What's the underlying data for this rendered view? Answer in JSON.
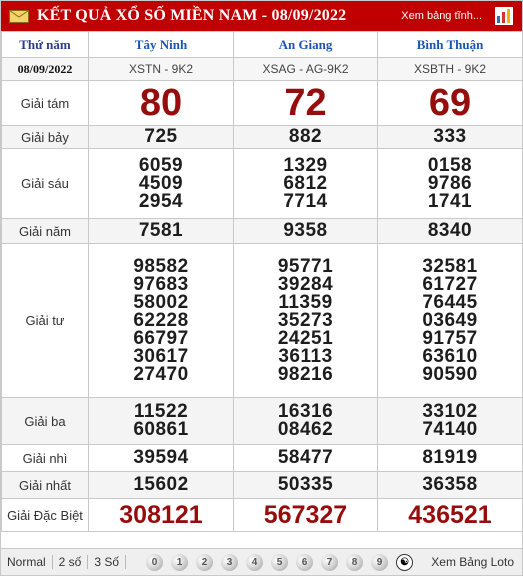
{
  "header": {
    "title": "KẾT QUẢ XỔ SỐ MIỀN NAM - 08/09/2022",
    "toggle_label": "Xem bảng tĩnh...",
    "accent_color": "#c00000"
  },
  "table": {
    "col_label_header": "Thứ năm",
    "date": "08/09/2022",
    "provinces": [
      {
        "name": "Tây Ninh",
        "code": "XSTN - 9K2"
      },
      {
        "name": "An Giang",
        "code": "XSAG - AG-9K2"
      },
      {
        "name": "Bình Thuận",
        "code": "XSBTH - 9K2"
      }
    ],
    "prizes": {
      "g8": {
        "label": "Giải tám",
        "values": [
          "80",
          "72",
          "69"
        ]
      },
      "g7": {
        "label": "Giải bảy",
        "values": [
          "725",
          "882",
          "333"
        ]
      },
      "g6": {
        "label": "Giải sáu",
        "values": [
          [
            "6059",
            "4509",
            "2954"
          ],
          [
            "1329",
            "6812",
            "7714"
          ],
          [
            "0158",
            "9786",
            "1741"
          ]
        ]
      },
      "g5": {
        "label": "Giải năm",
        "values": [
          "7581",
          "9358",
          "8340"
        ]
      },
      "g4": {
        "label": "Giải tư",
        "values": [
          [
            "98582",
            "97683",
            "58002",
            "62228",
            "66797",
            "30617",
            "27470"
          ],
          [
            "95771",
            "39284",
            "11359",
            "35273",
            "24251",
            "36113",
            "98216"
          ],
          [
            "32581",
            "61727",
            "76445",
            "03649",
            "91757",
            "63610",
            "90590"
          ]
        ]
      },
      "g3": {
        "label": "Giải ba",
        "values": [
          [
            "11522",
            "60861"
          ],
          [
            "16316",
            "08462"
          ],
          [
            "33102",
            "74140"
          ]
        ]
      },
      "g2": {
        "label": "Giải nhì",
        "values": [
          "39594",
          "58477",
          "81919"
        ]
      },
      "g1": {
        "label": "Giải nhất",
        "values": [
          "15602",
          "50335",
          "36358"
        ]
      },
      "db": {
        "label": "Giải Đặc Biệt",
        "values": [
          "308121",
          "567327",
          "436521"
        ]
      }
    }
  },
  "footer": {
    "options": [
      "Normal",
      "2 số",
      "3 Số"
    ],
    "digits": [
      "0",
      "1",
      "2",
      "3",
      "4",
      "5",
      "6",
      "7",
      "8",
      "9"
    ],
    "loto_label": "Xem Bảng Loto"
  }
}
